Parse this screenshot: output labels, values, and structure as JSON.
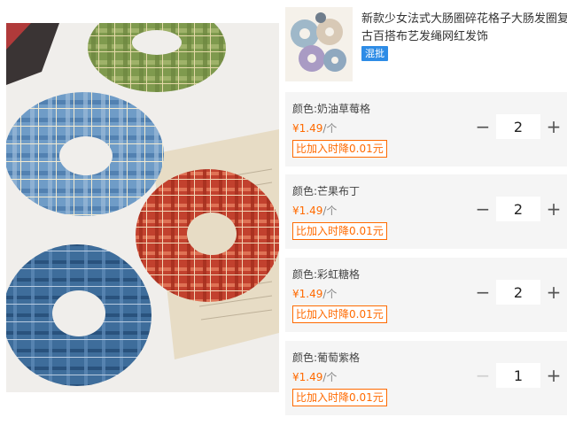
{
  "product": {
    "title_line1": "新款少女法式大肠圈碎花格子大肠发圈复",
    "title_line2": "古百搭布艺发绳网红发饰",
    "badge": "混批"
  },
  "skus": [
    {
      "name": "颜色:奶油草莓格",
      "currency": "¥",
      "price": "1.49",
      "unit": "/个",
      "price_drop": "比加入时降0.01元",
      "qty": "2",
      "minus_disabled": false
    },
    {
      "name": "颜色:芒果布丁",
      "currency": "¥",
      "price": "1.49",
      "unit": "/个",
      "price_drop": "比加入时降0.01元",
      "qty": "2",
      "minus_disabled": false
    },
    {
      "name": "颜色:彩虹糖格",
      "currency": "¥",
      "price": "1.49",
      "unit": "/个",
      "price_drop": "比加入时降0.01元",
      "qty": "2",
      "minus_disabled": false
    },
    {
      "name": "颜色:葡萄紫格",
      "currency": "¥",
      "price": "1.49",
      "unit": "/个",
      "price_drop": "比加入时降0.01元",
      "qty": "1",
      "minus_disabled": true
    }
  ],
  "stepper": {
    "minus": "−",
    "plus": "+"
  },
  "colors": {
    "accent": "#ff6a00",
    "badge": "#2e8ce6",
    "row_bg": "#f5f5f5"
  }
}
